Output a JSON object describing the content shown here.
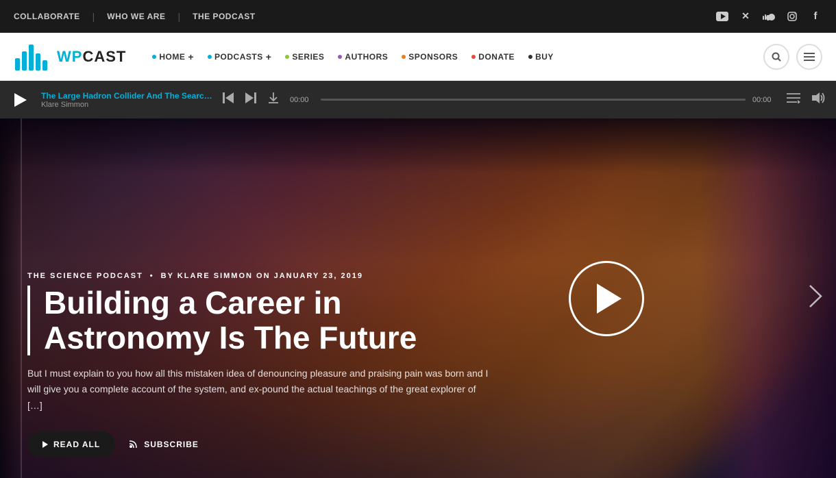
{
  "topnav": {
    "items": [
      {
        "label": "COLLABORATE",
        "id": "collaborate"
      },
      {
        "label": "WHO WE ARE",
        "id": "who-we-are"
      },
      {
        "label": "THE PODCAST",
        "id": "the-podcast"
      }
    ]
  },
  "social": {
    "youtube": "▶",
    "twitter": "✕",
    "soundcloud": "☁",
    "instagram": "◻",
    "facebook": "f"
  },
  "mainnav": {
    "logo_wp": "WP",
    "logo_cast": "CAST",
    "menu_items": [
      {
        "label": "HOME",
        "dot_class": "blue",
        "has_plus": true
      },
      {
        "label": "PODCASTS",
        "dot_class": "blue",
        "has_plus": true
      },
      {
        "label": "SERIES",
        "dot_class": "green",
        "has_plus": false
      },
      {
        "label": "AUTHORS",
        "dot_class": "purple",
        "has_plus": false
      },
      {
        "label": "SPONSORS",
        "dot_class": "orange",
        "has_plus": false
      },
      {
        "label": "DONATE",
        "dot_class": "red",
        "has_plus": false
      },
      {
        "label": "BUY",
        "dot_class": "dark",
        "has_plus": false
      }
    ]
  },
  "player": {
    "track_title": "The Large Hadron Collider And The Searc…",
    "track_author": "Klare Simmon",
    "time_start": "00:00",
    "time_end": "00:00"
  },
  "hero": {
    "category": "THE SCIENCE PODCAST",
    "meta": "BY KLARE SIMMON ON JANUARY 23, 2019",
    "title": "Building a Career in Astronomy Is The Future",
    "description": "But I must explain to you how all this mistaken idea of denouncing pleasure and praising pain was born and I will give you a complete account of the system, and ex-pound the actual teachings of the great explorer of […]",
    "read_all_label": "READ ALL",
    "subscribe_label": "SUBSCRIBE"
  }
}
